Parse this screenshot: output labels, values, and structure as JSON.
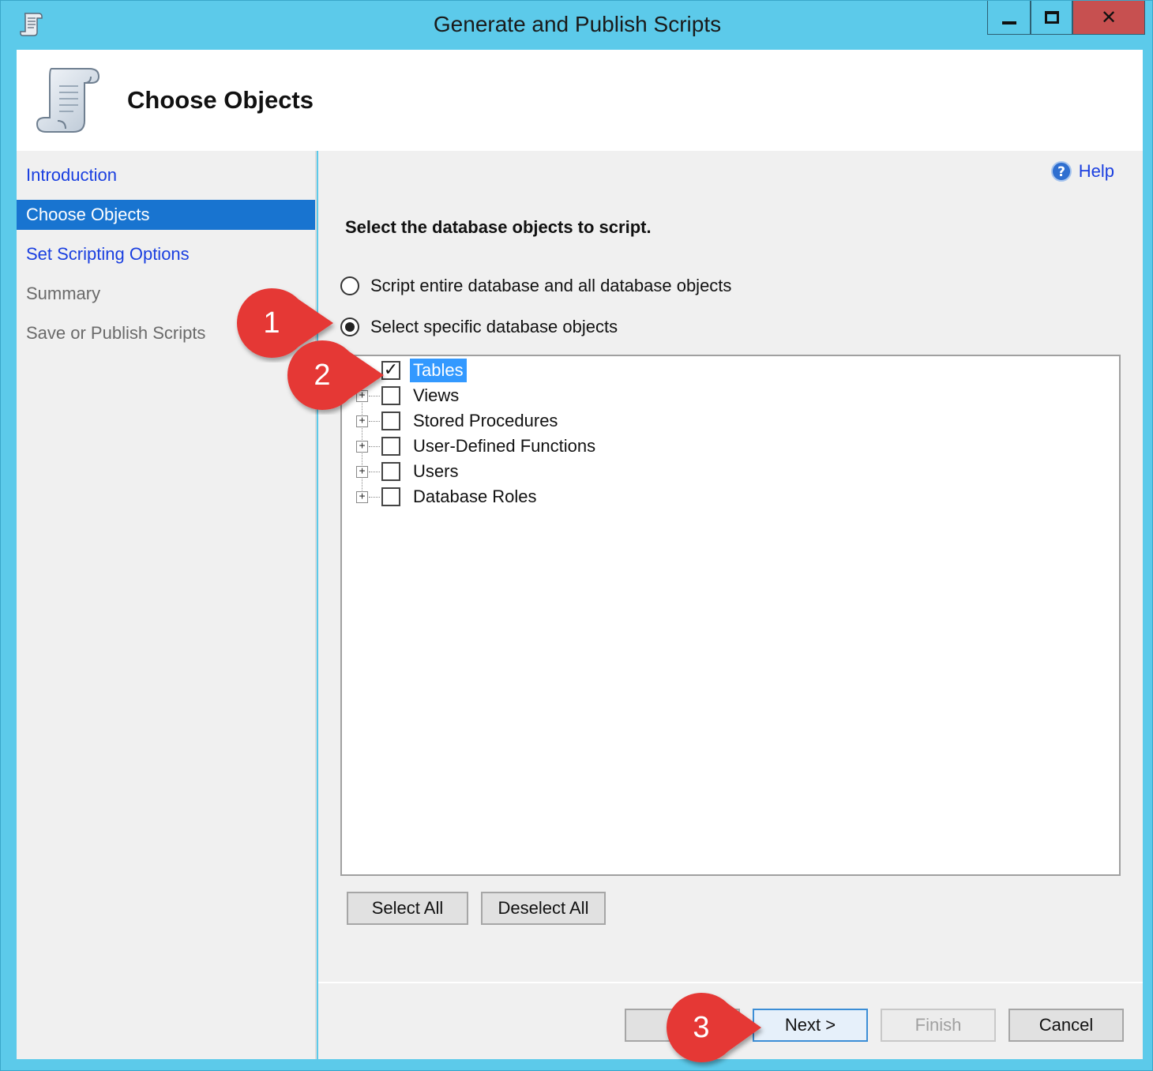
{
  "window": {
    "title": "Generate and Publish Scripts",
    "title_bar_color": "#5ccaea",
    "close_button_color": "#c75050"
  },
  "header": {
    "title": "Choose Objects",
    "icon": "script-scroll-icon"
  },
  "sidebar": {
    "items": [
      {
        "label": "Introduction",
        "state": "link"
      },
      {
        "label": "Choose Objects",
        "state": "active"
      },
      {
        "label": "Set Scripting Options",
        "state": "link"
      },
      {
        "label": "Summary",
        "state": "disabled"
      },
      {
        "label": "Save or Publish Scripts",
        "state": "disabled"
      }
    ]
  },
  "content": {
    "help_label": "Help",
    "prompt": "Select the database objects to script.",
    "radio_options": [
      {
        "label": "Script entire database and all database objects",
        "selected": false
      },
      {
        "label": "Select specific database objects",
        "selected": true
      }
    ],
    "tree_items": [
      {
        "label": "Tables",
        "checked": true,
        "selected": true
      },
      {
        "label": "Views",
        "checked": false
      },
      {
        "label": "Stored Procedures",
        "checked": false
      },
      {
        "label": "User-Defined Functions",
        "checked": false
      },
      {
        "label": "Users",
        "checked": false
      },
      {
        "label": "Database Roles",
        "checked": false
      }
    ],
    "select_all_label": "Select All",
    "deselect_all_label": "Deselect All"
  },
  "footer": {
    "previous_label": "< P",
    "next_label": "Next >",
    "finish_label": "Finish",
    "cancel_label": "Cancel"
  },
  "callouts": [
    {
      "number": "1",
      "color": "#e53935"
    },
    {
      "number": "2",
      "color": "#e53935"
    },
    {
      "number": "3",
      "color": "#e53935"
    }
  ]
}
